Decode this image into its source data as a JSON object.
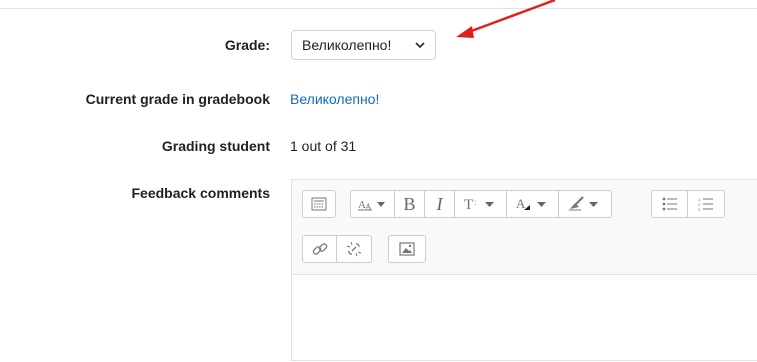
{
  "form": {
    "grade_label": "Grade:",
    "grade_value": "Великолепно!",
    "current_grade_label": "Current grade in gradebook",
    "current_grade_value": "Великолепно!",
    "grading_student_label": "Grading student",
    "grading_student_value": "1 out of 31",
    "feedback_label": "Feedback comments"
  },
  "editor_toolbar": {
    "icons": [
      "show-more-icon",
      "paragraph-styles-icon",
      "bold-icon",
      "italic-icon",
      "font-size-icon",
      "font-color-icon",
      "highlight-icon",
      "unordered-list-icon",
      "ordered-list-icon",
      "link-icon",
      "unlink-icon",
      "image-icon"
    ],
    "bold_glyph": "B",
    "italic_glyph": "I"
  },
  "colors": {
    "link": "#0f6cbf",
    "arrow": "#e0201a",
    "border": "#dee2e6"
  }
}
